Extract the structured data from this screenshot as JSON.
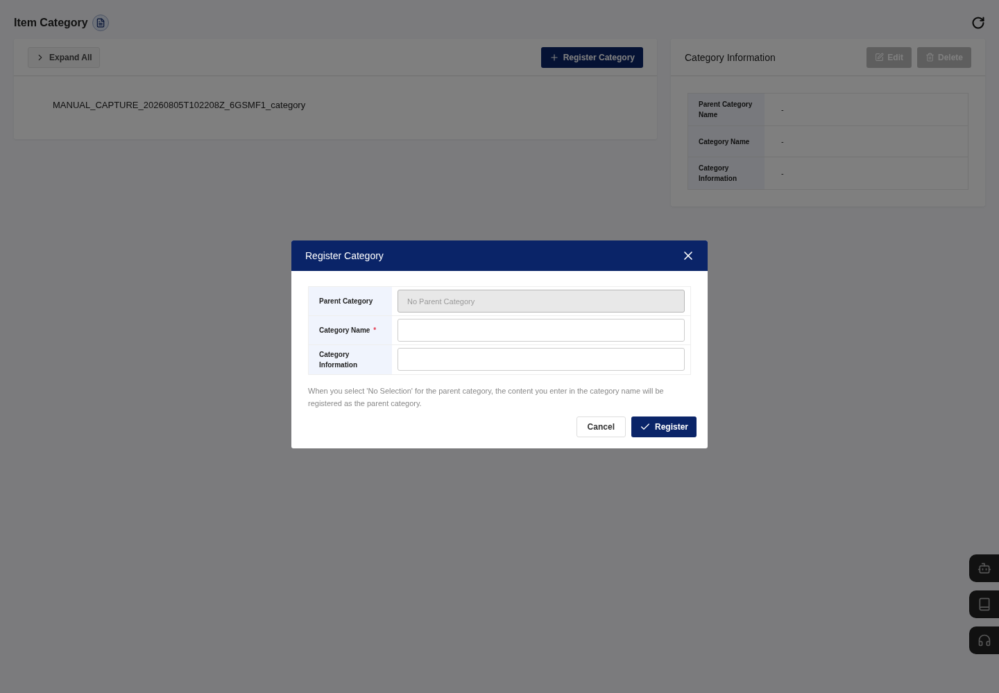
{
  "page": {
    "title": "Item Category"
  },
  "tree_panel": {
    "expand_button": "Expand All",
    "register_button": "Register Category",
    "items": [
      {
        "label": "MANUAL_CAPTURE_20260805T102208Z_6GSMF1_category"
      }
    ]
  },
  "info_panel": {
    "title": "Category Information",
    "buttons": [
      {
        "label": "Edit",
        "kind": "edit",
        "disabled": true
      },
      {
        "label": "Delete",
        "kind": "delete",
        "disabled": true
      }
    ],
    "rows": [
      {
        "label": "Parent Category Name",
        "value": "-"
      },
      {
        "label": "Category Name",
        "value": "-"
      },
      {
        "label": "Category Information",
        "value": "-"
      }
    ]
  },
  "dialog": {
    "title": "Register Category",
    "fields": [
      {
        "label": "Parent Category",
        "placeholder": "No Parent Category",
        "disabled": true
      },
      {
        "label": "Category Name",
        "required_mark": "*",
        "disabled": false
      },
      {
        "label": "Category Information",
        "disabled": false
      }
    ],
    "note": "When you select 'No Selection' for the parent category, the content you enter in the category name will be registered as the parent category.",
    "cancel": "Cancel",
    "confirm": "Register"
  },
  "side_buttons": [
    {
      "kind": "bot"
    },
    {
      "kind": "book"
    },
    {
      "kind": "headset"
    }
  ]
}
